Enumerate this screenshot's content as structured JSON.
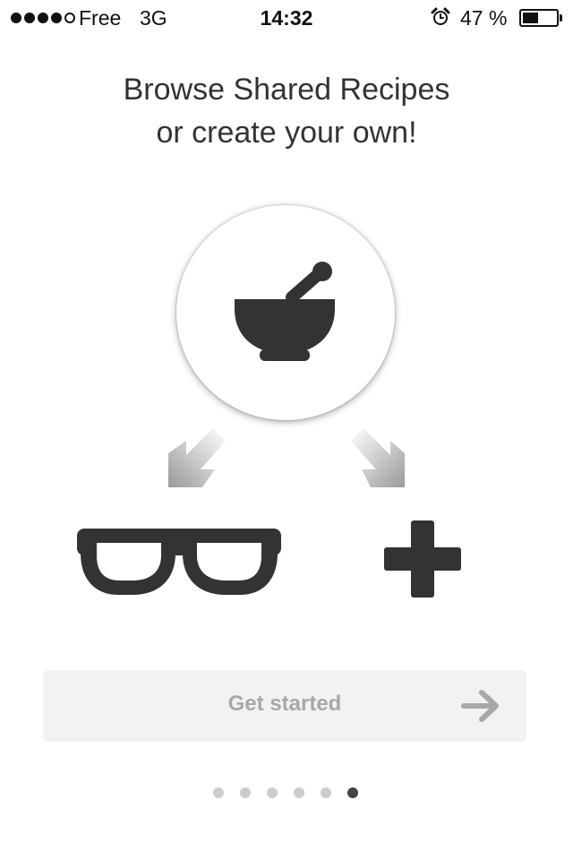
{
  "status_bar": {
    "signal_filled": 4,
    "signal_total": 5,
    "carrier": "Free",
    "network": "3G",
    "time": "14:32",
    "alarm_icon": "alarm-clock-icon",
    "battery_percent_text": "47 %",
    "battery_level": 0.47
  },
  "headline": {
    "line1": "Browse Shared Recipes",
    "line2": "or create your own!"
  },
  "illustration": {
    "center_icon": "mortar-and-pestle-icon",
    "left_arrow_icon": "arrow-down-left-icon",
    "right_arrow_icon": "arrow-down-right-icon",
    "browse_icon": "glasses-icon",
    "create_icon": "plus-icon"
  },
  "get_started": {
    "label": "Get started",
    "icon": "arrow-right-icon"
  },
  "pagination": {
    "total": 6,
    "active_index": 5
  },
  "colors": {
    "icon": "#333333",
    "heading": "#333333",
    "button_bg": "#f2f2f2",
    "button_text": "#a8a8a8",
    "dot_inactive": "#cccccc",
    "dot_active": "#444444"
  }
}
